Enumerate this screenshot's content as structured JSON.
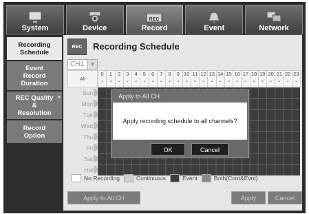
{
  "tabs": [
    {
      "label": "System",
      "icon": "monitor-icon"
    },
    {
      "label": "Device",
      "icon": "camera-icon"
    },
    {
      "label": "Record",
      "icon": "rec-icon"
    },
    {
      "label": "Event",
      "icon": "alarm-icon"
    },
    {
      "label": "Network",
      "icon": "network-icon"
    }
  ],
  "active_tab": "Record",
  "sidebar": {
    "items": [
      {
        "label_lines": [
          "Recording",
          "Schedule"
        ],
        "active": true
      },
      {
        "label_lines": [
          "Event",
          "Record",
          "Duration"
        ],
        "active": false
      },
      {
        "label_lines": [
          "REC Quality",
          "&",
          "Resolution"
        ],
        "active": false
      },
      {
        "label_lines": [
          "Record",
          "Option"
        ],
        "active": false
      }
    ]
  },
  "main": {
    "icon_text": "REC",
    "title": "Recording Schedule",
    "channel": "CH1",
    "all_label": "All",
    "hours": [
      "0",
      "1",
      "2",
      "3",
      "4",
      "5",
      "6",
      "7",
      "8",
      "9",
      "10",
      "11",
      "12",
      "13",
      "14",
      "15",
      "16",
      "17",
      "18",
      "19",
      "20",
      "21",
      "22",
      "23"
    ],
    "days": [
      "Sun",
      "Mon",
      "Tue",
      "Wed",
      "Thu",
      "Fri",
      "Sat",
      "Hol"
    ]
  },
  "legend": [
    {
      "label": "No Recording",
      "color": "#ffffff"
    },
    {
      "label": "Continuous",
      "color": "#cfcfcf"
    },
    {
      "label": "Event",
      "color": "#3c3c3c"
    },
    {
      "label": "Both(Cont&Evnt)",
      "color": "#8a8a8a"
    }
  ],
  "buttons": {
    "apply_all": "Apply to All CH",
    "apply": "Apply",
    "cancel": "Cancel"
  },
  "dialog": {
    "title": "Apply to All CH",
    "message": "Apply recording schedule to all channels?",
    "ok": "OK",
    "cancel": "Cancel"
  }
}
